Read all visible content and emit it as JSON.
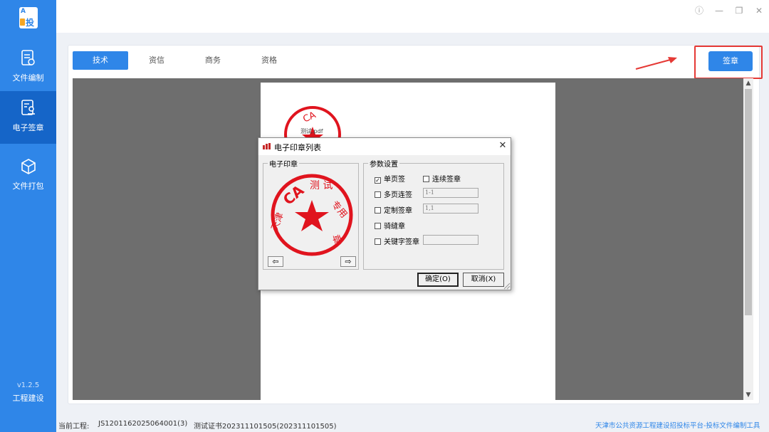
{
  "sidebar": {
    "logo_text": "投",
    "items": [
      {
        "label": "文件编制",
        "icon": "document-edit-icon"
      },
      {
        "label": "电子签章",
        "icon": "seal-stamp-icon"
      },
      {
        "label": "文件打包",
        "icon": "package-box-icon"
      }
    ],
    "version": "v1.2.5",
    "org": "工程建设"
  },
  "window": {
    "info_icon": "ⓘ",
    "minimize_icon": "—",
    "restore_icon": "❐",
    "close_icon": "✕"
  },
  "tabs": [
    "技术",
    "资信",
    "商务",
    "资格"
  ],
  "sign_button": "签章",
  "dialog": {
    "title": "电子印章列表",
    "seal_group": "电子印章",
    "params_group": "参数设置",
    "seal_text": "CA测试专用章",
    "seal_prefix": "天津",
    "options": {
      "single_page": "单页签",
      "continuous": "连续签章",
      "multi_page": "多页连签",
      "multi_page_value": "1-1",
      "custom": "定制签章",
      "custom_value": "1,1",
      "seam": "骑缝章",
      "keyword": "关键字签章",
      "keyword_value": ""
    },
    "checked": "✓",
    "ok": "确定(O)",
    "cancel": "取消(X)",
    "prev_arrow": "⇦",
    "next_arrow": "⇨"
  },
  "page_stamp_text": "测试.pdf",
  "footer": {
    "project_label": "当前工程:",
    "project_id": "JS1201162025064001(3)",
    "cert": "测试证书202311101505(202311101505)",
    "platform": "天津市公共资源工程建设招投标平台-投标文件编制工具"
  },
  "colors": {
    "brand": "#2f86e8",
    "sidebar_active": "#1565c8",
    "seal_red": "#e0141e",
    "annotation_red": "#e53935"
  }
}
